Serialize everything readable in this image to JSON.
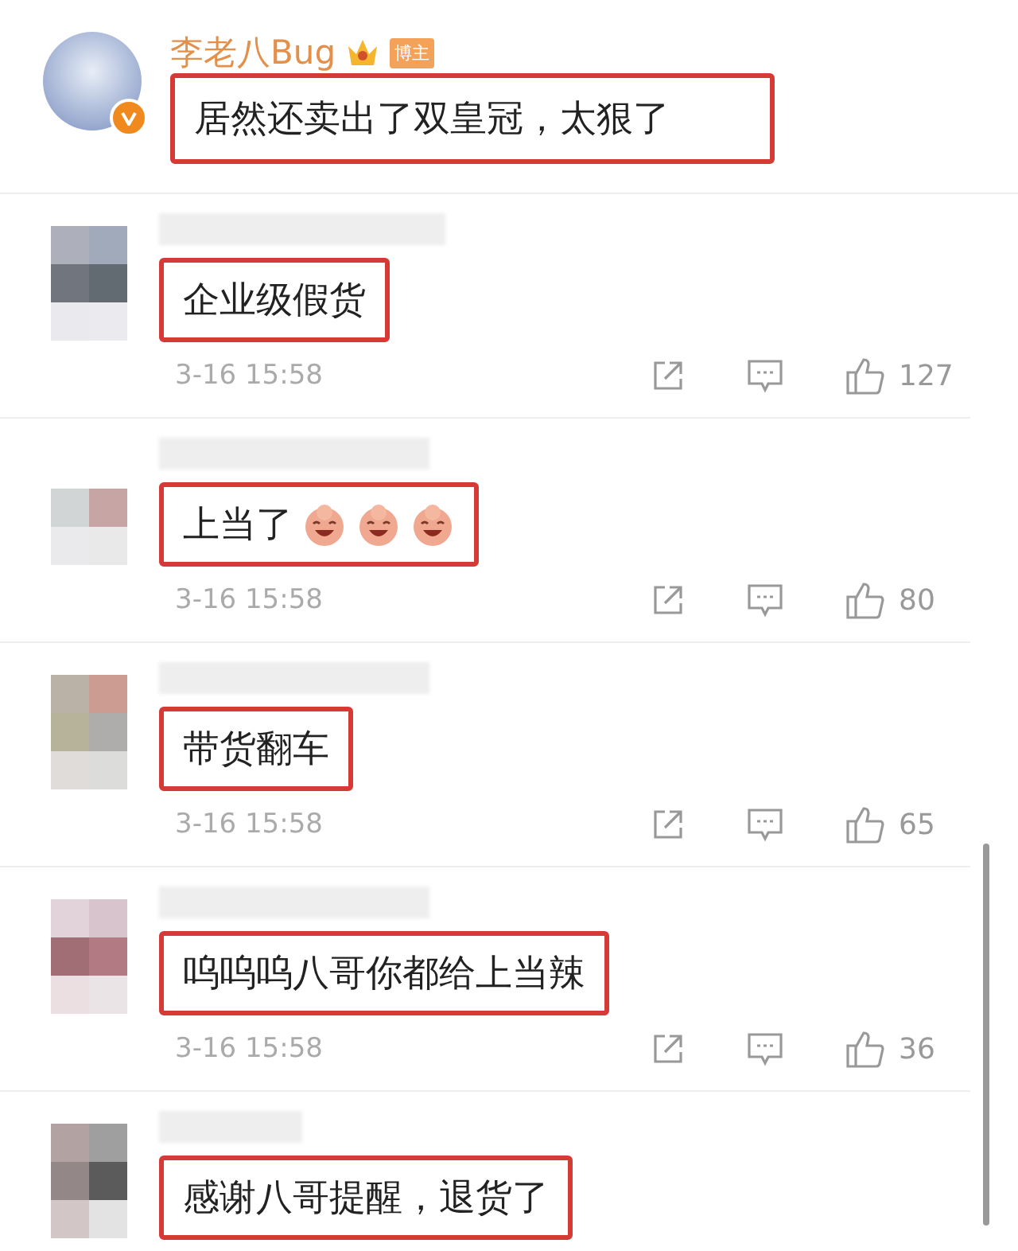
{
  "post": {
    "author": "李老八Bug",
    "badge": "博主",
    "crown": true,
    "verified": true,
    "text": "居然还卖出了双皇冠，太狠了",
    "highlighted": true
  },
  "comments": [
    {
      "text": "企业级假货",
      "highlighted": true,
      "time": "3-16 15:58",
      "likes": "127"
    },
    {
      "text": "上当了",
      "highlighted": true,
      "emojis": [
        {
          "kind": "laughing"
        },
        {
          "kind": "laughing"
        },
        {
          "kind": "laughing"
        }
      ],
      "time": "3-16 15:58",
      "likes": "80"
    },
    {
      "text": "带货翻车",
      "highlighted": true,
      "time": "3-16 15:58",
      "likes": "65"
    },
    {
      "text": "呜呜呜八哥你都给上当辣",
      "highlighted": true,
      "time": "3-16 15:58",
      "likes": "36"
    },
    {
      "text": "感谢八哥提醒，退货了",
      "highlighted": true
    }
  ]
}
